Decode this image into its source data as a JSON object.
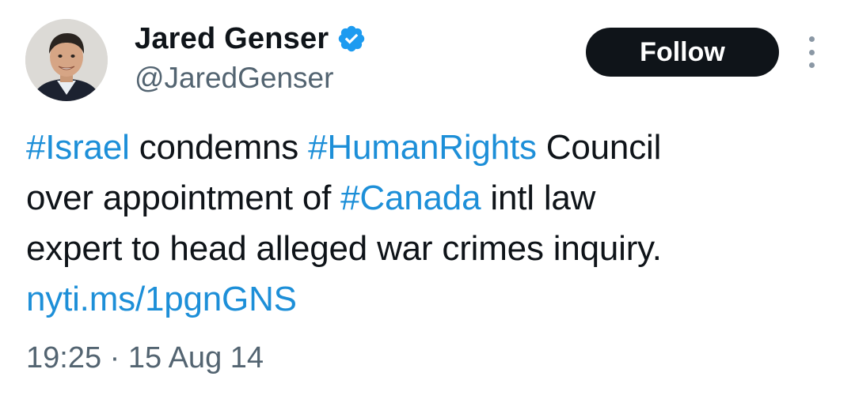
{
  "author": {
    "display_name": "Jared Genser",
    "handle": "@JaredGenser",
    "verified": true
  },
  "actions": {
    "follow_label": "Follow"
  },
  "tweet": {
    "lines": [
      [
        {
          "type": "hashtag",
          "text": "#Israel"
        },
        {
          "type": "text",
          "text": " condemns "
        },
        {
          "type": "hashtag",
          "text": "#HumanRights"
        },
        {
          "type": "text",
          "text": " Council"
        }
      ],
      [
        {
          "type": "text",
          "text": "over appointment of "
        },
        {
          "type": "hashtag",
          "text": "#Canada"
        },
        {
          "type": "text",
          "text": " intl law"
        }
      ],
      [
        {
          "type": "text",
          "text": "expert to head alleged war crimes inquiry."
        }
      ],
      [
        {
          "type": "link",
          "text": "nyti.ms/1pgnGNS"
        }
      ]
    ],
    "timestamp": "19:25 · 15 Aug 14"
  },
  "colors": {
    "link": "#1d8fd8",
    "verified_badge": "#1d9bf0",
    "follow_bg": "#0f1419",
    "secondary_text": "#536471"
  },
  "icons": {
    "verified": "verified-badge-icon",
    "more": "more-options-icon",
    "avatar": "profile-photo"
  }
}
